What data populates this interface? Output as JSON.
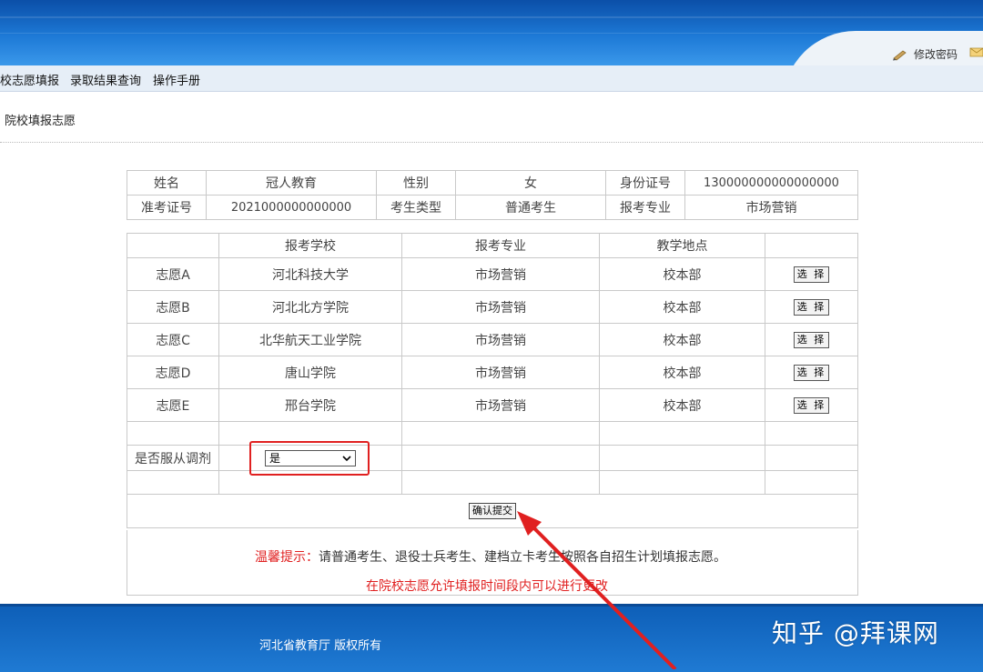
{
  "header": {
    "change_password": "修改密码"
  },
  "nav": {
    "items": [
      "校志愿填报",
      "录取结果查询",
      "操作手册"
    ]
  },
  "breadcrumb": "院校填报志愿",
  "student": {
    "name_label": "姓名",
    "name": "冠人教育",
    "gender_label": "性别",
    "gender": "女",
    "id_label": "身份证号",
    "id": "130000000000000000",
    "exam_no_label": "准考证号",
    "exam_no": "2021000000000000",
    "type_label": "考生类型",
    "type": "普通考生",
    "major_label": "报考专业",
    "major": "市场营销"
  },
  "choices": {
    "headers": [
      "",
      "报考学校",
      "报考专业",
      "教学地点",
      ""
    ],
    "select_label": "选 择",
    "rows": [
      {
        "label": "志愿A",
        "school": "河北科技大学",
        "major": "市场营销",
        "campus": "校本部"
      },
      {
        "label": "志愿B",
        "school": "河北北方学院",
        "major": "市场营销",
        "campus": "校本部"
      },
      {
        "label": "志愿C",
        "school": "北华航天工业学院",
        "major": "市场营销",
        "campus": "校本部"
      },
      {
        "label": "志愿D",
        "school": "唐山学院",
        "major": "市场营销",
        "campus": "校本部"
      },
      {
        "label": "志愿E",
        "school": "邢台学院",
        "major": "市场营销",
        "campus": "校本部"
      }
    ],
    "tiaoji_label": "是否服从调剂",
    "tiaoji_value": "是"
  },
  "submit_label": "确认提交",
  "tip": {
    "label": "温馨提示：",
    "text": "请普通考生、退役士兵考生、建档立卡考生按照各自招生计划填报志愿。"
  },
  "note2": "在院校志愿允许填报时间段内可以进行更改",
  "footer": {
    "copyright": "河北省教育厅  版权所有",
    "watermark": "知乎 @拜课网"
  },
  "colors": {
    "header_blue": "#1d79d6",
    "highlight_red": "#e02020"
  }
}
